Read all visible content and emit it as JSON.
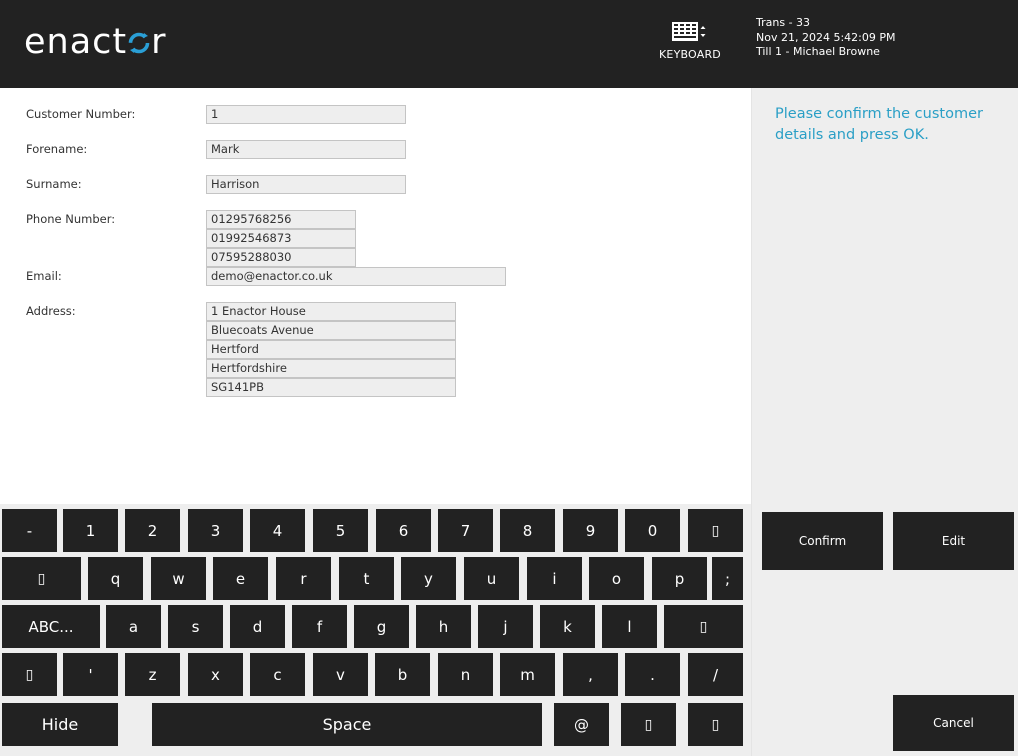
{
  "header": {
    "logo_text_main": "enact",
    "logo_text_o": "o",
    "logo_text_end": "r",
    "keyboard_label": "KEYBOARD",
    "trans": "Trans - 33",
    "datetime": "Nov 21, 2024 5:42:09 PM",
    "till": "Till 1 - Michael Browne"
  },
  "form": {
    "customer_number_label": "Customer Number:",
    "customer_number": "1",
    "forename_label": "Forename:",
    "forename": "Mark",
    "surname_label": "Surname:",
    "surname": "Harrison",
    "phone_label": "Phone Number:",
    "phones": [
      "01295768256",
      "01992546873",
      "07595288030"
    ],
    "email_label": "Email:",
    "email": "demo@enactor.co.uk",
    "address_label": "Address:",
    "address": [
      "1 Enactor House",
      "Bluecoats Avenue",
      "Hertford",
      "Hertfordshire",
      "SG141PB"
    ]
  },
  "side": {
    "prompt": "Please confirm the customer details and press OK.",
    "confirm_label": "Confirm",
    "edit_label": "Edit",
    "cancel_label": "Cancel"
  },
  "keyboard": {
    "row1": [
      "-",
      "1",
      "2",
      "3",
      "4",
      "5",
      "6",
      "7",
      "8",
      "9",
      "0",
      "▯"
    ],
    "row2": [
      "▯",
      "q",
      "w",
      "e",
      "r",
      "t",
      "y",
      "u",
      "i",
      "o",
      "p",
      ";"
    ],
    "row3": [
      "ABC...",
      "a",
      "s",
      "d",
      "f",
      "g",
      "h",
      "j",
      "k",
      "l",
      "▯"
    ],
    "row4": [
      "▯",
      "'",
      "z",
      "x",
      "c",
      "v",
      "b",
      "n",
      "m",
      ",",
      ".",
      "/"
    ],
    "row5": [
      "Hide",
      "Space",
      "@",
      "▯",
      "▯"
    ]
  }
}
